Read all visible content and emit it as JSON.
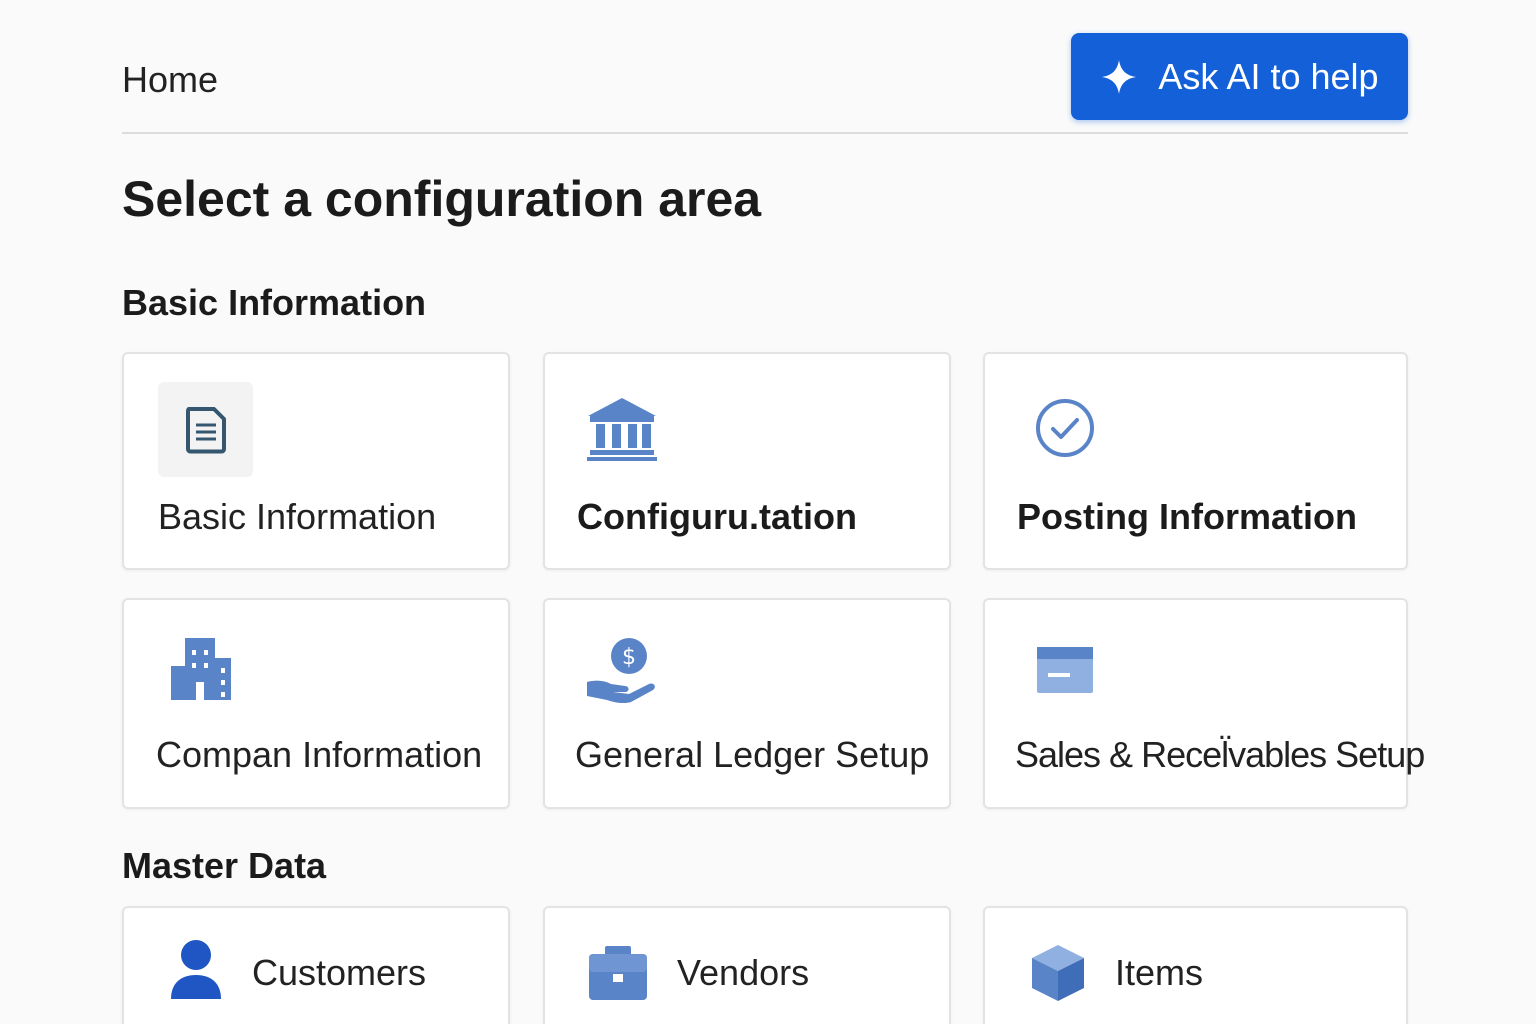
{
  "header": {
    "breadcrumb": "Home",
    "ai_button_label": "Ask AI to help"
  },
  "page_title": "Select a configuration area",
  "sections": [
    {
      "title": "Basic Information",
      "cards": [
        {
          "label": "Basic Information",
          "icon": "document-icon"
        },
        {
          "label": "Configuru.tation",
          "icon": "bank-icon"
        },
        {
          "label": "Posting Information",
          "icon": "check-circle-icon"
        },
        {
          "label": "Compan Information",
          "icon": "building-icon"
        },
        {
          "label": "General Ledger Setup",
          "icon": "hand-coin-icon"
        },
        {
          "label": "Sales & Recel̈vables Setup",
          "icon": "card-icon"
        }
      ]
    },
    {
      "title": "Master Data",
      "cards": [
        {
          "label": "Customers",
          "icon": "person-icon"
        },
        {
          "label": "Vendors",
          "icon": "briefcase-icon"
        },
        {
          "label": "Items",
          "icon": "cube-icon"
        }
      ]
    }
  ],
  "colors": {
    "accent": "#1460d8",
    "icon_blue": "#5a84c8",
    "icon_dark": "#34566e"
  }
}
